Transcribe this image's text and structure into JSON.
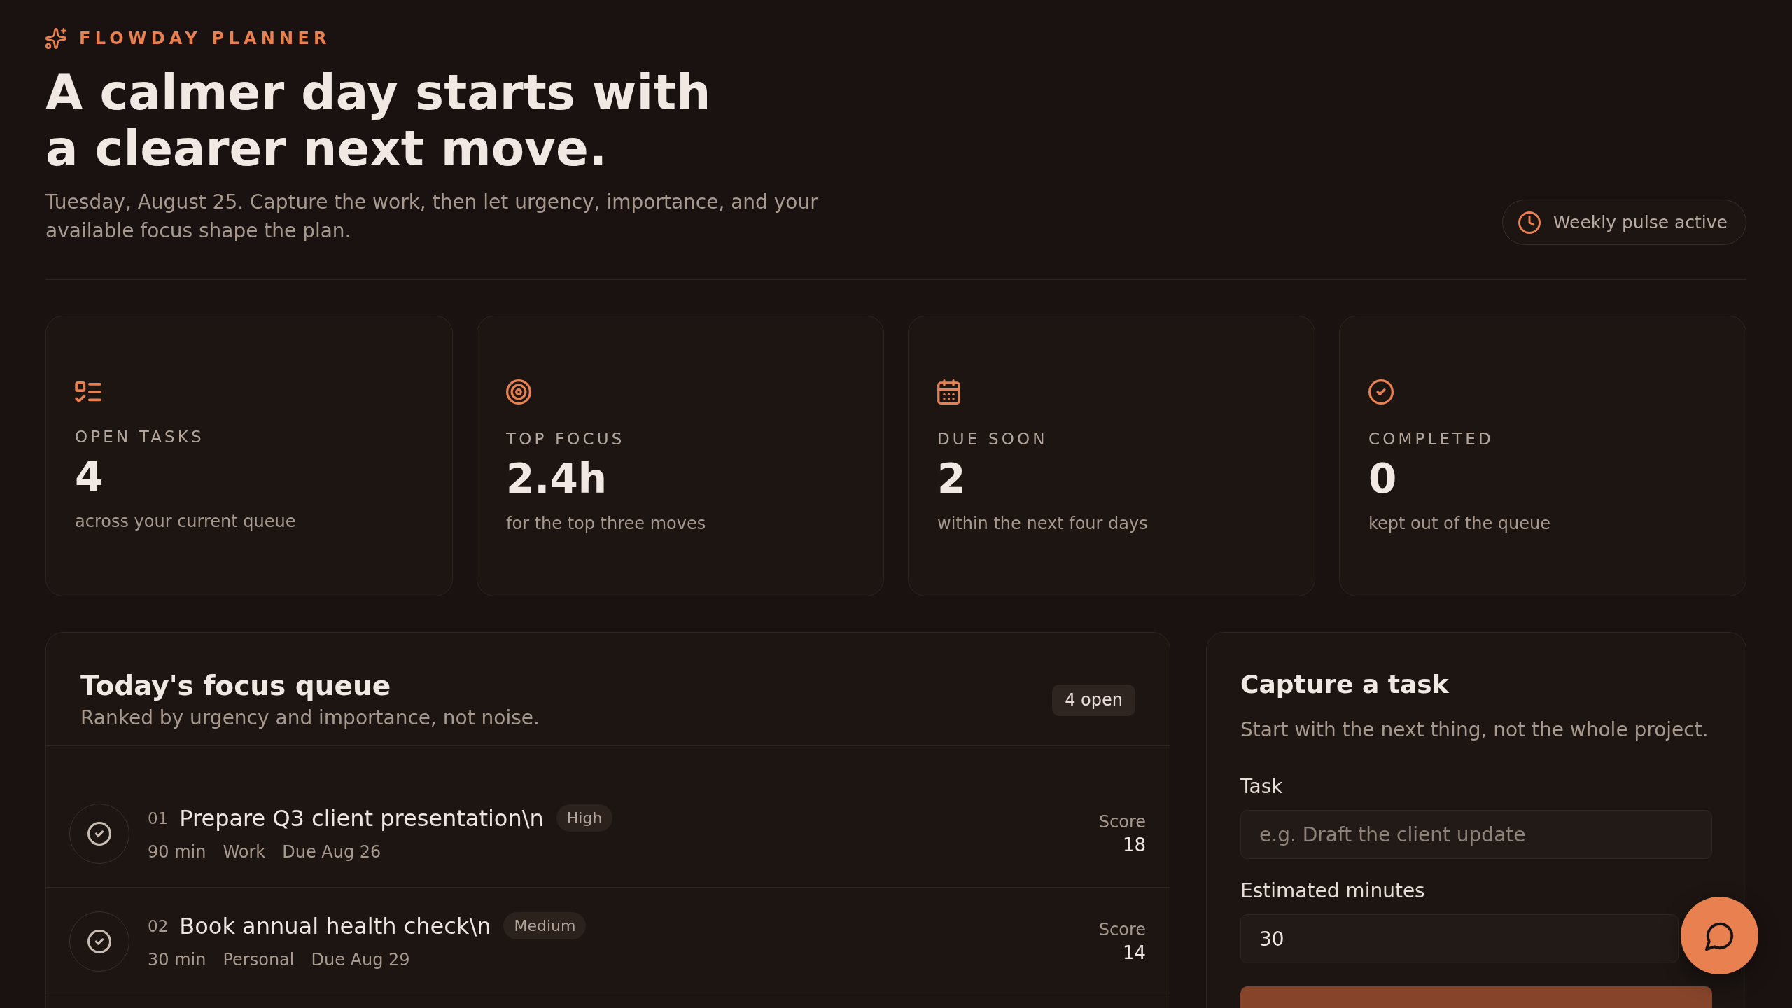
{
  "brand": {
    "name": "FLOWDAY PLANNER"
  },
  "header": {
    "title": "A calmer day starts with a clearer next move.",
    "subtitle": "Tuesday, August 25. Capture the work, then let urgency, importance, and your available focus shape the plan.",
    "status": {
      "label": "Weekly pulse active"
    }
  },
  "stats": [
    {
      "kind": "open",
      "label": "OPEN TASKS",
      "value": "4",
      "caption": "across your current queue"
    },
    {
      "kind": "focus",
      "label": "TOP FOCUS",
      "value": "2.4h",
      "caption": "for the top three moves"
    },
    {
      "kind": "due",
      "label": "DUE SOON",
      "value": "2",
      "caption": "within the next four days"
    },
    {
      "kind": "completed",
      "label": "COMPLETED",
      "value": "0",
      "caption": "kept out of the queue"
    }
  ],
  "queue": {
    "title": "Today's focus queue",
    "subtitle": "Ranked by urgency and importance, not noise.",
    "badge": "4 open",
    "tasks": [
      {
        "number": "01",
        "title": "Prepare Q3 client presentation\\n",
        "priority": "High",
        "duration": "90 min",
        "category": "Work",
        "due": "Due Aug 26",
        "score_label": "Score",
        "score": "18"
      },
      {
        "number": "02",
        "title": "Book annual health check\\n",
        "priority": "Medium",
        "duration": "30 min",
        "category": "Personal",
        "due": "Due Aug 29",
        "score_label": "Score",
        "score": "14"
      }
    ]
  },
  "capture": {
    "title": "Capture a task",
    "subtitle": "Start with the next thing, not the whole project.",
    "fields": [
      {
        "label": "Task",
        "placeholder": "e.g. Draft the client update"
      },
      {
        "label": "Estimated minutes",
        "value": "30"
      }
    ]
  }
}
